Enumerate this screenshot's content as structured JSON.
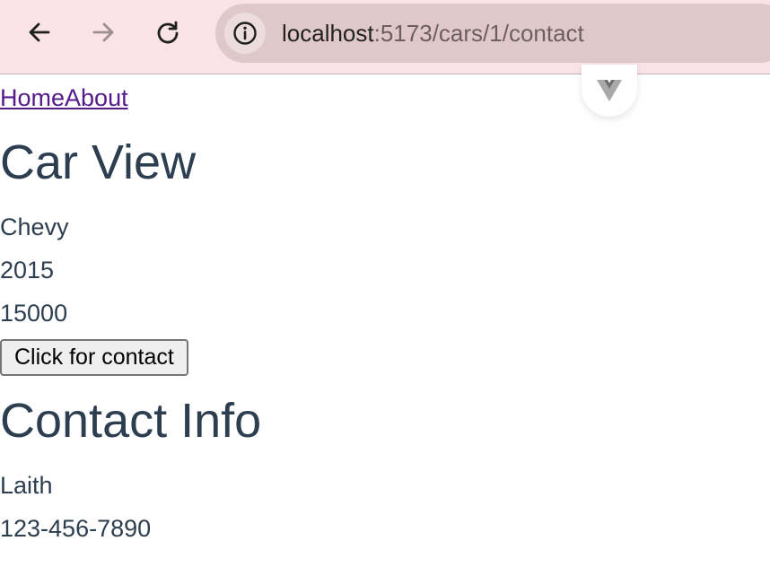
{
  "browser": {
    "url_host": "localhost",
    "url_path": ":5173/cars/1/contact",
    "icons": {
      "back": "arrow-left-icon",
      "forward": "arrow-right-icon",
      "reload": "reload-icon",
      "site_info": "info-icon",
      "devtools": "vue-logo-icon"
    }
  },
  "nav": {
    "home_label": "Home",
    "about_label": "About"
  },
  "car": {
    "title": "Car View",
    "make": "Chevy",
    "year": "2015",
    "price": "15000",
    "button_label": "Click for contact"
  },
  "contact": {
    "title": "Contact Info",
    "name": "Laith",
    "phone": "123-456-7890"
  },
  "colors": {
    "text": "#2c3e50",
    "link_visited": "#551a8b",
    "browser_bar": "#f9e3e6",
    "omnibox": "#dfc7ca"
  }
}
